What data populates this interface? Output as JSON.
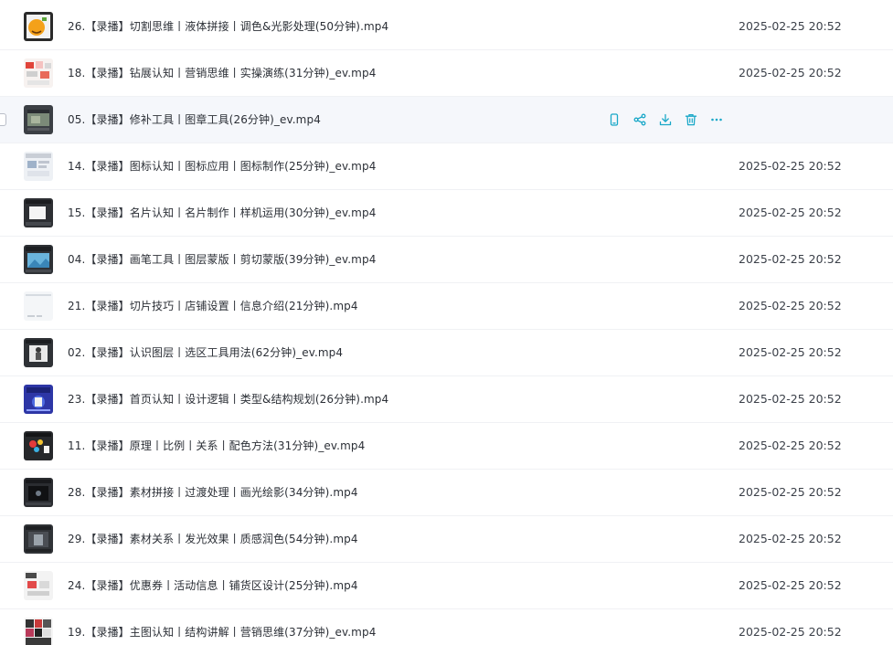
{
  "files": [
    {
      "name": "26.【录播】切割思维丨液体拼接丨调色&光影处理(50分钟).mp4",
      "date": "2025-02-25 20:52"
    },
    {
      "name": "18.【录播】钻展认知丨营销思维丨实操演练(31分钟)_ev.mp4",
      "date": "2025-02-25 20:52"
    },
    {
      "name": "05.【录播】修补工具丨图章工具(26分钟)_ev.mp4",
      "date": ""
    },
    {
      "name": "14.【录播】图标认知丨图标应用丨图标制作(25分钟)_ev.mp4",
      "date": "2025-02-25 20:52"
    },
    {
      "name": "15.【录播】名片认知丨名片制作丨样机运用(30分钟)_ev.mp4",
      "date": "2025-02-25 20:52"
    },
    {
      "name": "04.【录播】画笔工具丨图层蒙版丨剪切蒙版(39分钟)_ev.mp4",
      "date": "2025-02-25 20:52"
    },
    {
      "name": "21.【录播】切片技巧丨店铺设置丨信息介绍(21分钟).mp4",
      "date": "2025-02-25 20:52"
    },
    {
      "name": "02.【录播】认识图层丨选区工具用法(62分钟)_ev.mp4",
      "date": "2025-02-25 20:52"
    },
    {
      "name": "23.【录播】首页认知丨设计逻辑丨类型&结构规划(26分钟).mp4",
      "date": "2025-02-25 20:52"
    },
    {
      "name": "11.【录播】原理丨比例丨关系丨配色方法(31分钟)_ev.mp4",
      "date": "2025-02-25 20:52"
    },
    {
      "name": "28.【录播】素材拼接丨过渡处理丨画光绘影(34分钟).mp4",
      "date": "2025-02-25 20:52"
    },
    {
      "name": "29.【录播】素材关系丨发光效果丨质感润色(54分钟).mp4",
      "date": "2025-02-25 20:52"
    },
    {
      "name": "24.【录播】优惠券丨活动信息丨铺货区设计(25分钟).mp4",
      "date": "2025-02-25 20:52"
    },
    {
      "name": "19.【录播】主图认知丨结构讲解丨营销思维(37分钟)_ev.mp4",
      "date": "2025-02-25 20:52"
    }
  ],
  "hovered_row": 2,
  "row_actions": [
    "phone-icon",
    "share-icon",
    "download-icon",
    "trash-icon",
    "more-icon"
  ],
  "colors": {
    "accent": "#1aa8c8",
    "text": "#2b2f36",
    "date_text": "#3b4049",
    "hover_bg": "#f5f7fb",
    "divider": "#f0f1f4"
  }
}
